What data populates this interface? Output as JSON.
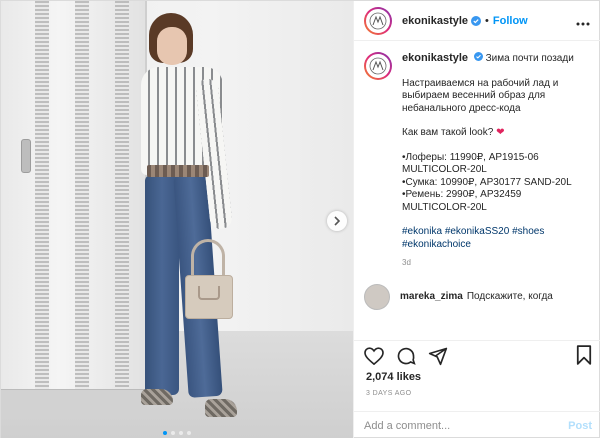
{
  "account": {
    "username": "ekonikastyle",
    "separator": "•",
    "follow_label": "Follow"
  },
  "caption": {
    "first_line": "Зима почти позади",
    "lines_a": [
      "Настраиваемся на рабочий лад и",
      "выбираем весенний образ для",
      "небанального дресс-кода"
    ],
    "question": "Как вам такой look?",
    "items": [
      "•Лоферы: 11990₽, AP1915-06",
      "MULTICOLOR-20L",
      "•Сумка: 10990₽, AP30177 SAND-20L",
      "•Ремень: 2990₽, AP32459",
      "MULTICOLOR-20L"
    ],
    "hashtags_line1": [
      "#ekonika",
      "#ekonikaSS20",
      "#shoes"
    ],
    "hashtags_line2": [
      "#ekonikachoice"
    ],
    "age": "3d"
  },
  "comment": {
    "username": "mareka_zima",
    "text": "Подскажите, когда"
  },
  "likes": "2,074 likes",
  "timestamp": "3 DAYS AGO",
  "add_comment": {
    "placeholder": "Add a comment...",
    "post_label": "Post"
  },
  "carousel": {
    "count": 4,
    "active": 0
  },
  "icons": [
    "more-options-icon",
    "verified-icon",
    "heart-icon",
    "comment-icon",
    "share-icon",
    "bookmark-icon",
    "next-arrow-icon"
  ],
  "colors": {
    "accent": "#0095f6",
    "post_disabled": "#b2dffc",
    "hashtag": "#00376b",
    "muted": "#8e8e8e"
  }
}
